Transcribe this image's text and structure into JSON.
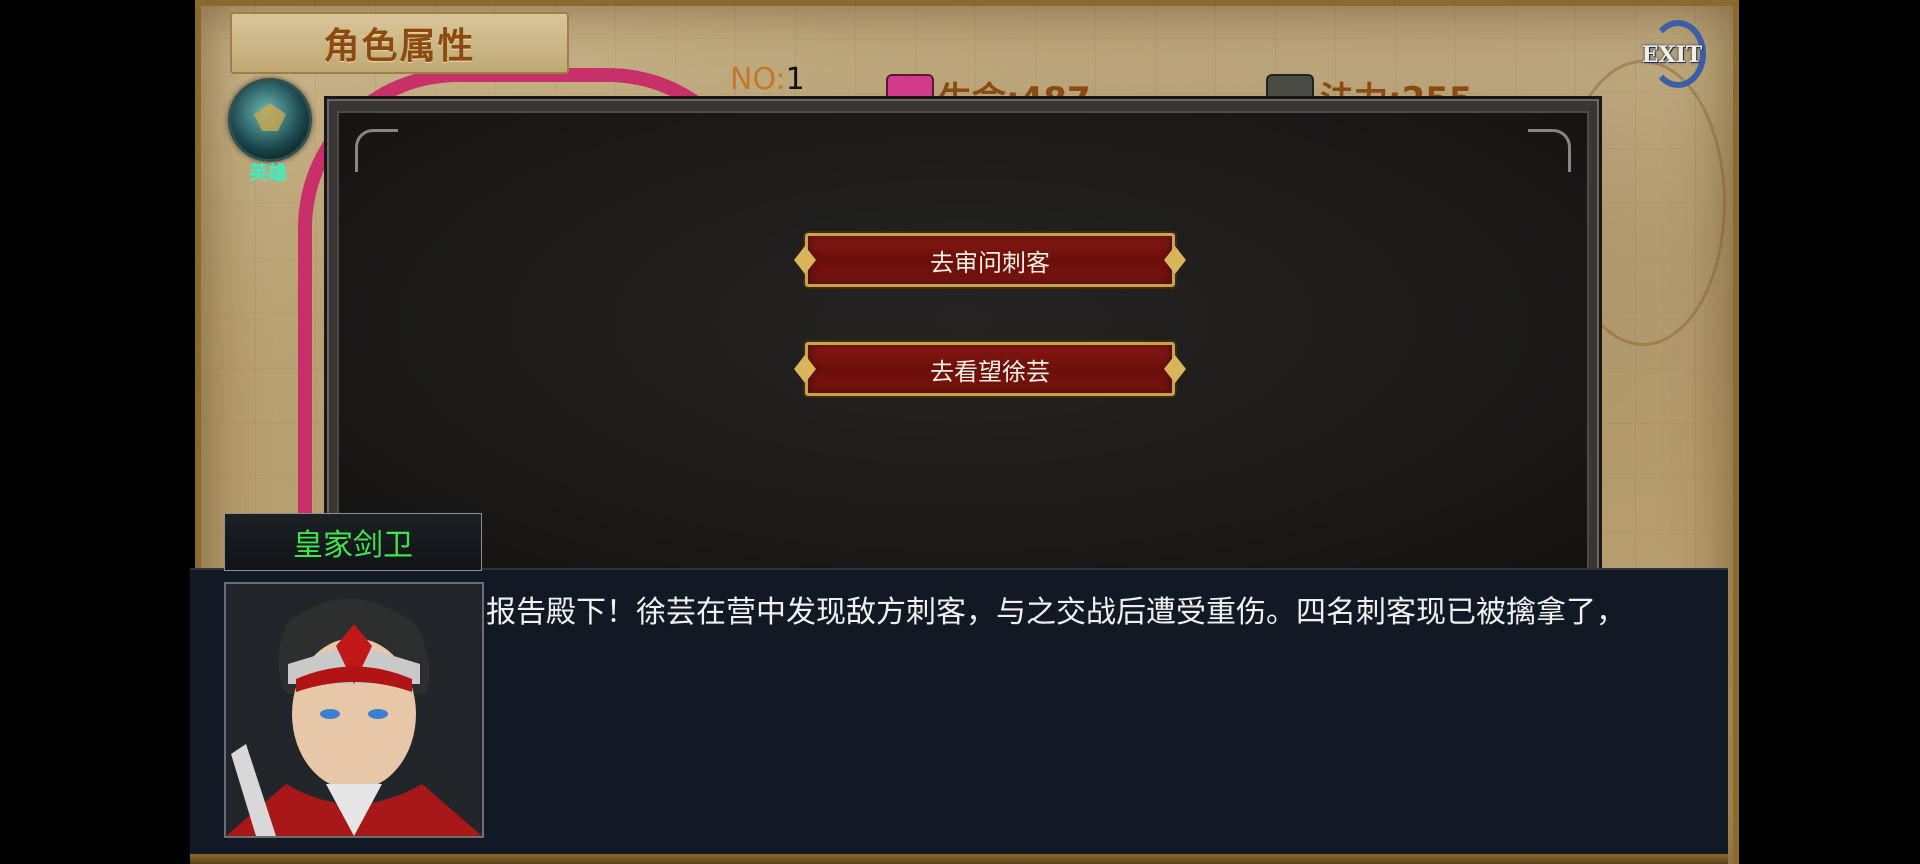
{
  "header": {
    "title": "角色属性",
    "no_prefix": "NO:",
    "no_value": "1",
    "life_label": "生命:487",
    "mana_label": "法力:255",
    "exit_label": "EXIT"
  },
  "hero": {
    "rank_label": "英雄"
  },
  "choices": [
    {
      "label": "去审问刺客"
    },
    {
      "label": "去看望徐芸"
    }
  ],
  "dialogue": {
    "speaker": "皇家剑卫",
    "text": "报告殿下！徐芸在营中发现敌方刺客，与之交战后遭受重伤。四名刺客现已被擒拿了，"
  },
  "colors": {
    "speaker_name": "#3ee44a",
    "hero_label": "#39f0c4",
    "button_fill": "#7c1510",
    "button_border": "#c9a24a",
    "title_text": "#8a4a10"
  },
  "icons": {
    "exit": "exit-icon",
    "life": "heart-icon",
    "mana": "mana-icon",
    "hero_badge": "hero-emblem-icon"
  }
}
